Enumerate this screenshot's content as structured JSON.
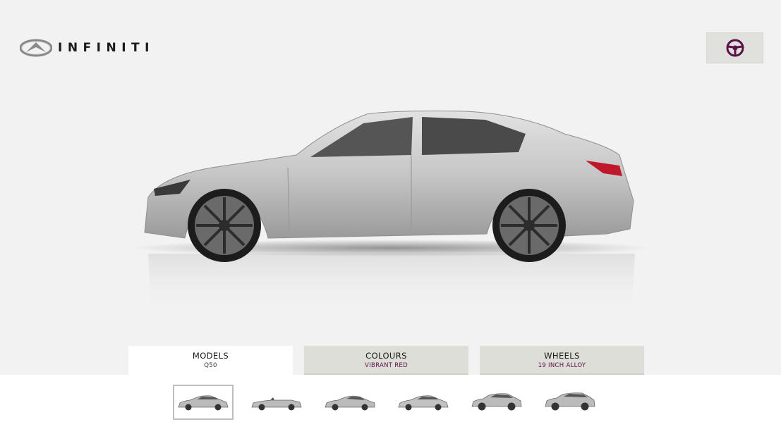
{
  "brand": {
    "name": "INFINITI"
  },
  "tabs": [
    {
      "title": "MODELS",
      "value": "Q50",
      "active": true
    },
    {
      "title": "COLOURS",
      "value": "VIBRANT RED",
      "active": false
    },
    {
      "title": "WHEELS",
      "value": "19 INCH ALLOY",
      "active": false
    }
  ],
  "models": [
    {
      "name": "sedan",
      "selected": true
    },
    {
      "name": "convertible",
      "selected": false
    },
    {
      "name": "coupe",
      "selected": false
    },
    {
      "name": "sport-sedan",
      "selected": false
    },
    {
      "name": "crossover",
      "selected": false
    },
    {
      "name": "suv",
      "selected": false
    }
  ],
  "icons": {
    "wheel_button": "steering-wheel-icon"
  },
  "colors": {
    "accent": "#5a1048",
    "car_body": "#c8c8c8",
    "tail_light": "#c0172a"
  }
}
